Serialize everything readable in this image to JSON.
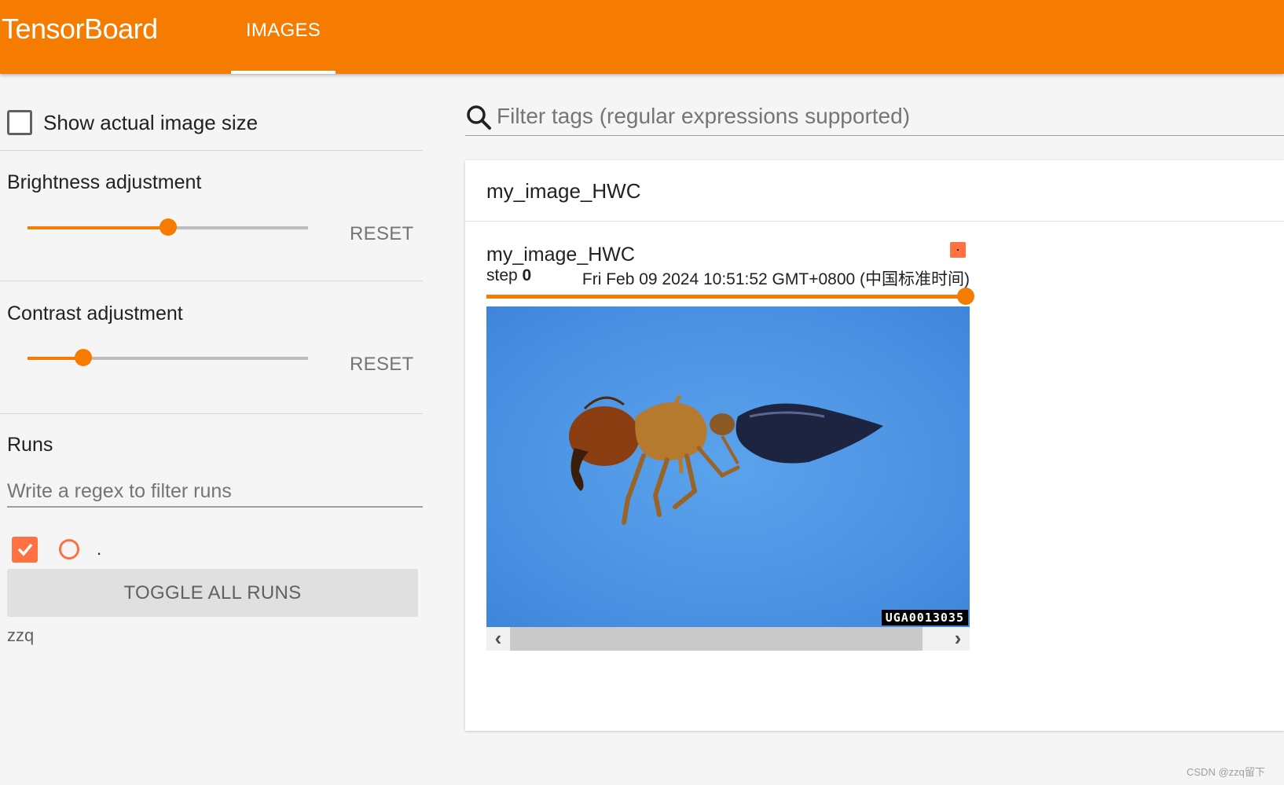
{
  "app": {
    "brand": "TensorBoard",
    "tabs": [
      {
        "label": "IMAGES",
        "active": true
      }
    ],
    "accent_color": "#f57c00",
    "run_color": "#ff7043"
  },
  "sidebar": {
    "show_actual_size": {
      "label": "Show actual image size",
      "checked": false
    },
    "brightness": {
      "title": "Brightness adjustment",
      "value_fraction": 0.5,
      "reset_label": "RESET"
    },
    "contrast": {
      "title": "Contrast adjustment",
      "value_fraction": 0.2,
      "reset_label": "RESET"
    },
    "runs": {
      "title": "Runs",
      "filter_placeholder": "Write a regex to filter runs",
      "items": [
        {
          "name": ".",
          "checked": true
        }
      ],
      "toggle_label": "TOGGLE ALL RUNS",
      "log_dir": "zzq"
    }
  },
  "main": {
    "search": {
      "placeholder": "Filter tags (regular expressions supported)",
      "icon": "search-icon"
    },
    "card": {
      "title": "my_image_HWC",
      "image": {
        "tag": "my_image_HWC",
        "step_label": "step",
        "step_value": "0",
        "timestamp": "Fri Feb 09 2024 10:51:52 GMT+0800 (中国标准时间)",
        "step_fraction": 1.0,
        "image_id_label": "UGA0013035",
        "image_description": "ant photo",
        "scroll_left": "‹",
        "scroll_right": "›"
      }
    }
  },
  "footer": {
    "watermark": "CSDN @zzq留下"
  }
}
